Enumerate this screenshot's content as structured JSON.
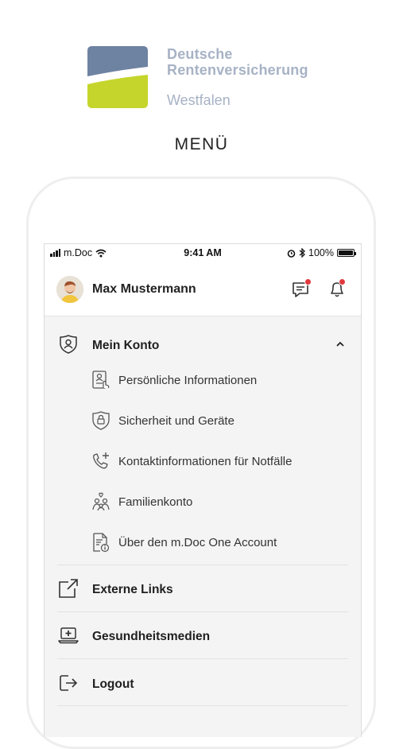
{
  "brand": {
    "line1": "Deutsche",
    "line2": "Rentenversicherung",
    "line3": "Westfalen",
    "colors": {
      "blue": "#6e82a2",
      "green": "#c5d52b",
      "text": "#a7b2c5"
    }
  },
  "page_title": "MENÜ",
  "statusbar": {
    "carrier": "m.Doc",
    "time": "9:41 AM",
    "battery": "100%"
  },
  "header": {
    "user_name": "Max Mustermann",
    "chat_icon": "chat-icon",
    "bell_icon": "bell-icon",
    "badge_color": "#e0393e"
  },
  "menu": {
    "account": {
      "label": "Mein Konto",
      "icon": "user-shield-icon",
      "expanded": true,
      "items": [
        {
          "label": "Persönliche Informationen",
          "icon": "id-card-icon"
        },
        {
          "label": "Sicherheit und Geräte",
          "icon": "shield-lock-icon"
        },
        {
          "label": "Kontaktinformationen für Notfälle",
          "icon": "phone-plus-icon"
        },
        {
          "label": "Familienkonto",
          "icon": "family-icon"
        },
        {
          "label": "Über den m.Doc One Account",
          "icon": "document-info-icon"
        }
      ]
    },
    "external_links": {
      "label": "Externe Links",
      "icon": "external-link-icon"
    },
    "health_media": {
      "label": "Gesundheitsmedien",
      "icon": "medical-laptop-icon"
    },
    "logout": {
      "label": "Logout",
      "icon": "logout-icon"
    }
  }
}
